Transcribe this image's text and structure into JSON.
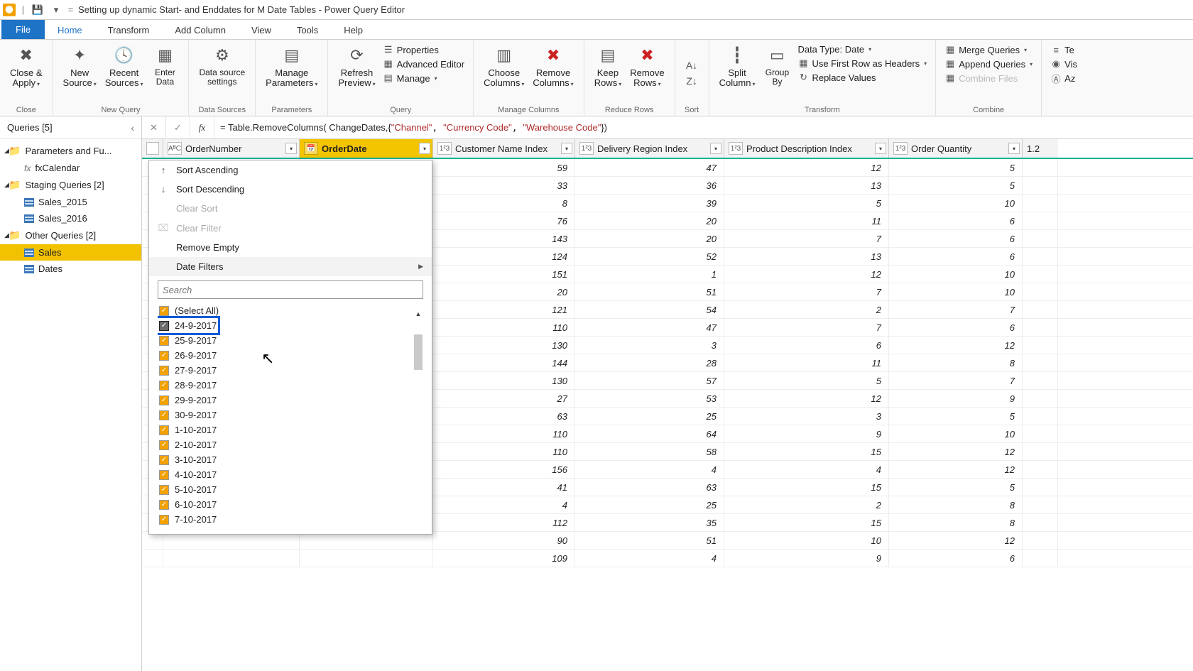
{
  "title": "Setting up dynamic Start- and Enddates for M Date Tables - Power Query Editor",
  "tabs": {
    "file": "File",
    "home": "Home",
    "transform": "Transform",
    "addcol": "Add Column",
    "view": "View",
    "tools": "Tools",
    "help": "Help"
  },
  "ribbon": {
    "close": {
      "btn": "Close &\nApply",
      "group": "Close"
    },
    "newquery": {
      "new": "New\nSource",
      "recent": "Recent\nSources",
      "enter": "Enter\nData",
      "group": "New Query"
    },
    "datasources": {
      "btn": "Data source\nsettings",
      "group": "Data Sources"
    },
    "params": {
      "btn": "Manage\nParameters",
      "group": "Parameters"
    },
    "query": {
      "refresh": "Refresh\nPreview",
      "properties": "Properties",
      "adveditor": "Advanced Editor",
      "manage": "Manage",
      "group": "Query"
    },
    "managecols": {
      "choose": "Choose\nColumns",
      "remove": "Remove\nColumns",
      "group": "Manage Columns"
    },
    "reducerows": {
      "keep": "Keep\nRows",
      "remove": "Remove\nRows",
      "group": "Reduce Rows"
    },
    "sort": {
      "group": "Sort"
    },
    "transform": {
      "split": "Split\nColumn",
      "group": "Group\nBy",
      "datatype": "Data Type: Date",
      "firstrow": "Use First Row as Headers",
      "replace": "Replace Values",
      "grp": "Transform"
    },
    "combine": {
      "merge": "Merge Queries",
      "append": "Append Queries",
      "combine": "Combine Files",
      "group": "Combine"
    },
    "ai": {
      "text": "Te",
      "vis": "Vis",
      "az": "Az"
    }
  },
  "queries": {
    "title": "Queries [5]",
    "groups": [
      {
        "label": "Parameters and Fu...",
        "items": [
          {
            "label": "fxCalendar",
            "type": "fx"
          }
        ]
      },
      {
        "label": "Staging Queries [2]",
        "items": [
          {
            "label": "Sales_2015",
            "type": "tbl"
          },
          {
            "label": "Sales_2016",
            "type": "tbl"
          }
        ]
      },
      {
        "label": "Other Queries [2]",
        "items": [
          {
            "label": "Sales",
            "type": "tbl",
            "sel": true
          },
          {
            "label": "Dates",
            "type": "tbl"
          }
        ]
      }
    ]
  },
  "formula_pre": "= Table.RemoveColumns( ChangeDates,{",
  "formula_s1": "\"Channel\"",
  "formula_s2": "\"Currency Code\"",
  "formula_s3": "\"Warehouse Code\"",
  "formula_post": "})",
  "columns": {
    "order": "OrderNumber",
    "date": "OrderDate",
    "cust": "Customer Name Index",
    "deliv": "Delivery Region Index",
    "prod": "Product Description Index",
    "qty": "Order Quantity"
  },
  "rows": [
    {
      "ci": 59,
      "di": 47,
      "pi": 12,
      "oq": 5
    },
    {
      "ci": 33,
      "di": 36,
      "pi": 13,
      "oq": 5
    },
    {
      "ci": 8,
      "di": 39,
      "pi": 5,
      "oq": 10
    },
    {
      "ci": 76,
      "di": 20,
      "pi": 11,
      "oq": 6
    },
    {
      "ci": 143,
      "di": 20,
      "pi": 7,
      "oq": 6
    },
    {
      "ci": 124,
      "di": 52,
      "pi": 13,
      "oq": 6
    },
    {
      "ci": 151,
      "di": 1,
      "pi": 12,
      "oq": 10
    },
    {
      "ci": 20,
      "di": 51,
      "pi": 7,
      "oq": 10
    },
    {
      "ci": 121,
      "di": 54,
      "pi": 2,
      "oq": 7
    },
    {
      "ci": 110,
      "di": 47,
      "pi": 7,
      "oq": 6
    },
    {
      "ci": 130,
      "di": 3,
      "pi": 6,
      "oq": 12
    },
    {
      "ci": 144,
      "di": 28,
      "pi": 11,
      "oq": 8
    },
    {
      "ci": 130,
      "di": 57,
      "pi": 5,
      "oq": 7
    },
    {
      "ci": 27,
      "di": 53,
      "pi": 12,
      "oq": 9
    },
    {
      "ci": 63,
      "di": 25,
      "pi": 3,
      "oq": 5
    },
    {
      "ci": 110,
      "di": 64,
      "pi": 9,
      "oq": 10
    },
    {
      "ci": 110,
      "di": 58,
      "pi": 15,
      "oq": 12
    },
    {
      "ci": 156,
      "di": 4,
      "pi": 4,
      "oq": 12
    },
    {
      "ci": 41,
      "di": 63,
      "pi": 15,
      "oq": 5
    },
    {
      "ci": 4,
      "di": 25,
      "pi": 2,
      "oq": 8
    },
    {
      "ci": 112,
      "di": 35,
      "pi": 15,
      "oq": 8
    },
    {
      "ci": 90,
      "di": 51,
      "pi": 10,
      "oq": 12
    },
    {
      "ci": 109,
      "di": 4,
      "pi": 9,
      "oq": 6
    }
  ],
  "filter": {
    "sortasc": "Sort Ascending",
    "sortdesc": "Sort Descending",
    "clearsort": "Clear Sort",
    "clearfilter": "Clear Filter",
    "removeempty": "Remove Empty",
    "datefilters": "Date Filters",
    "search": "Search",
    "selectall": "(Select All)",
    "dates": [
      "24-9-2017",
      "25-9-2017",
      "26-9-2017",
      "27-9-2017",
      "28-9-2017",
      "29-9-2017",
      "30-9-2017",
      "1-10-2017",
      "2-10-2017",
      "3-10-2017",
      "4-10-2017",
      "5-10-2017",
      "6-10-2017",
      "7-10-2017"
    ]
  },
  "type_num": "1²3",
  "type_txt": "AᴮC",
  "type_cal": "📅",
  "last_col": "1.2"
}
